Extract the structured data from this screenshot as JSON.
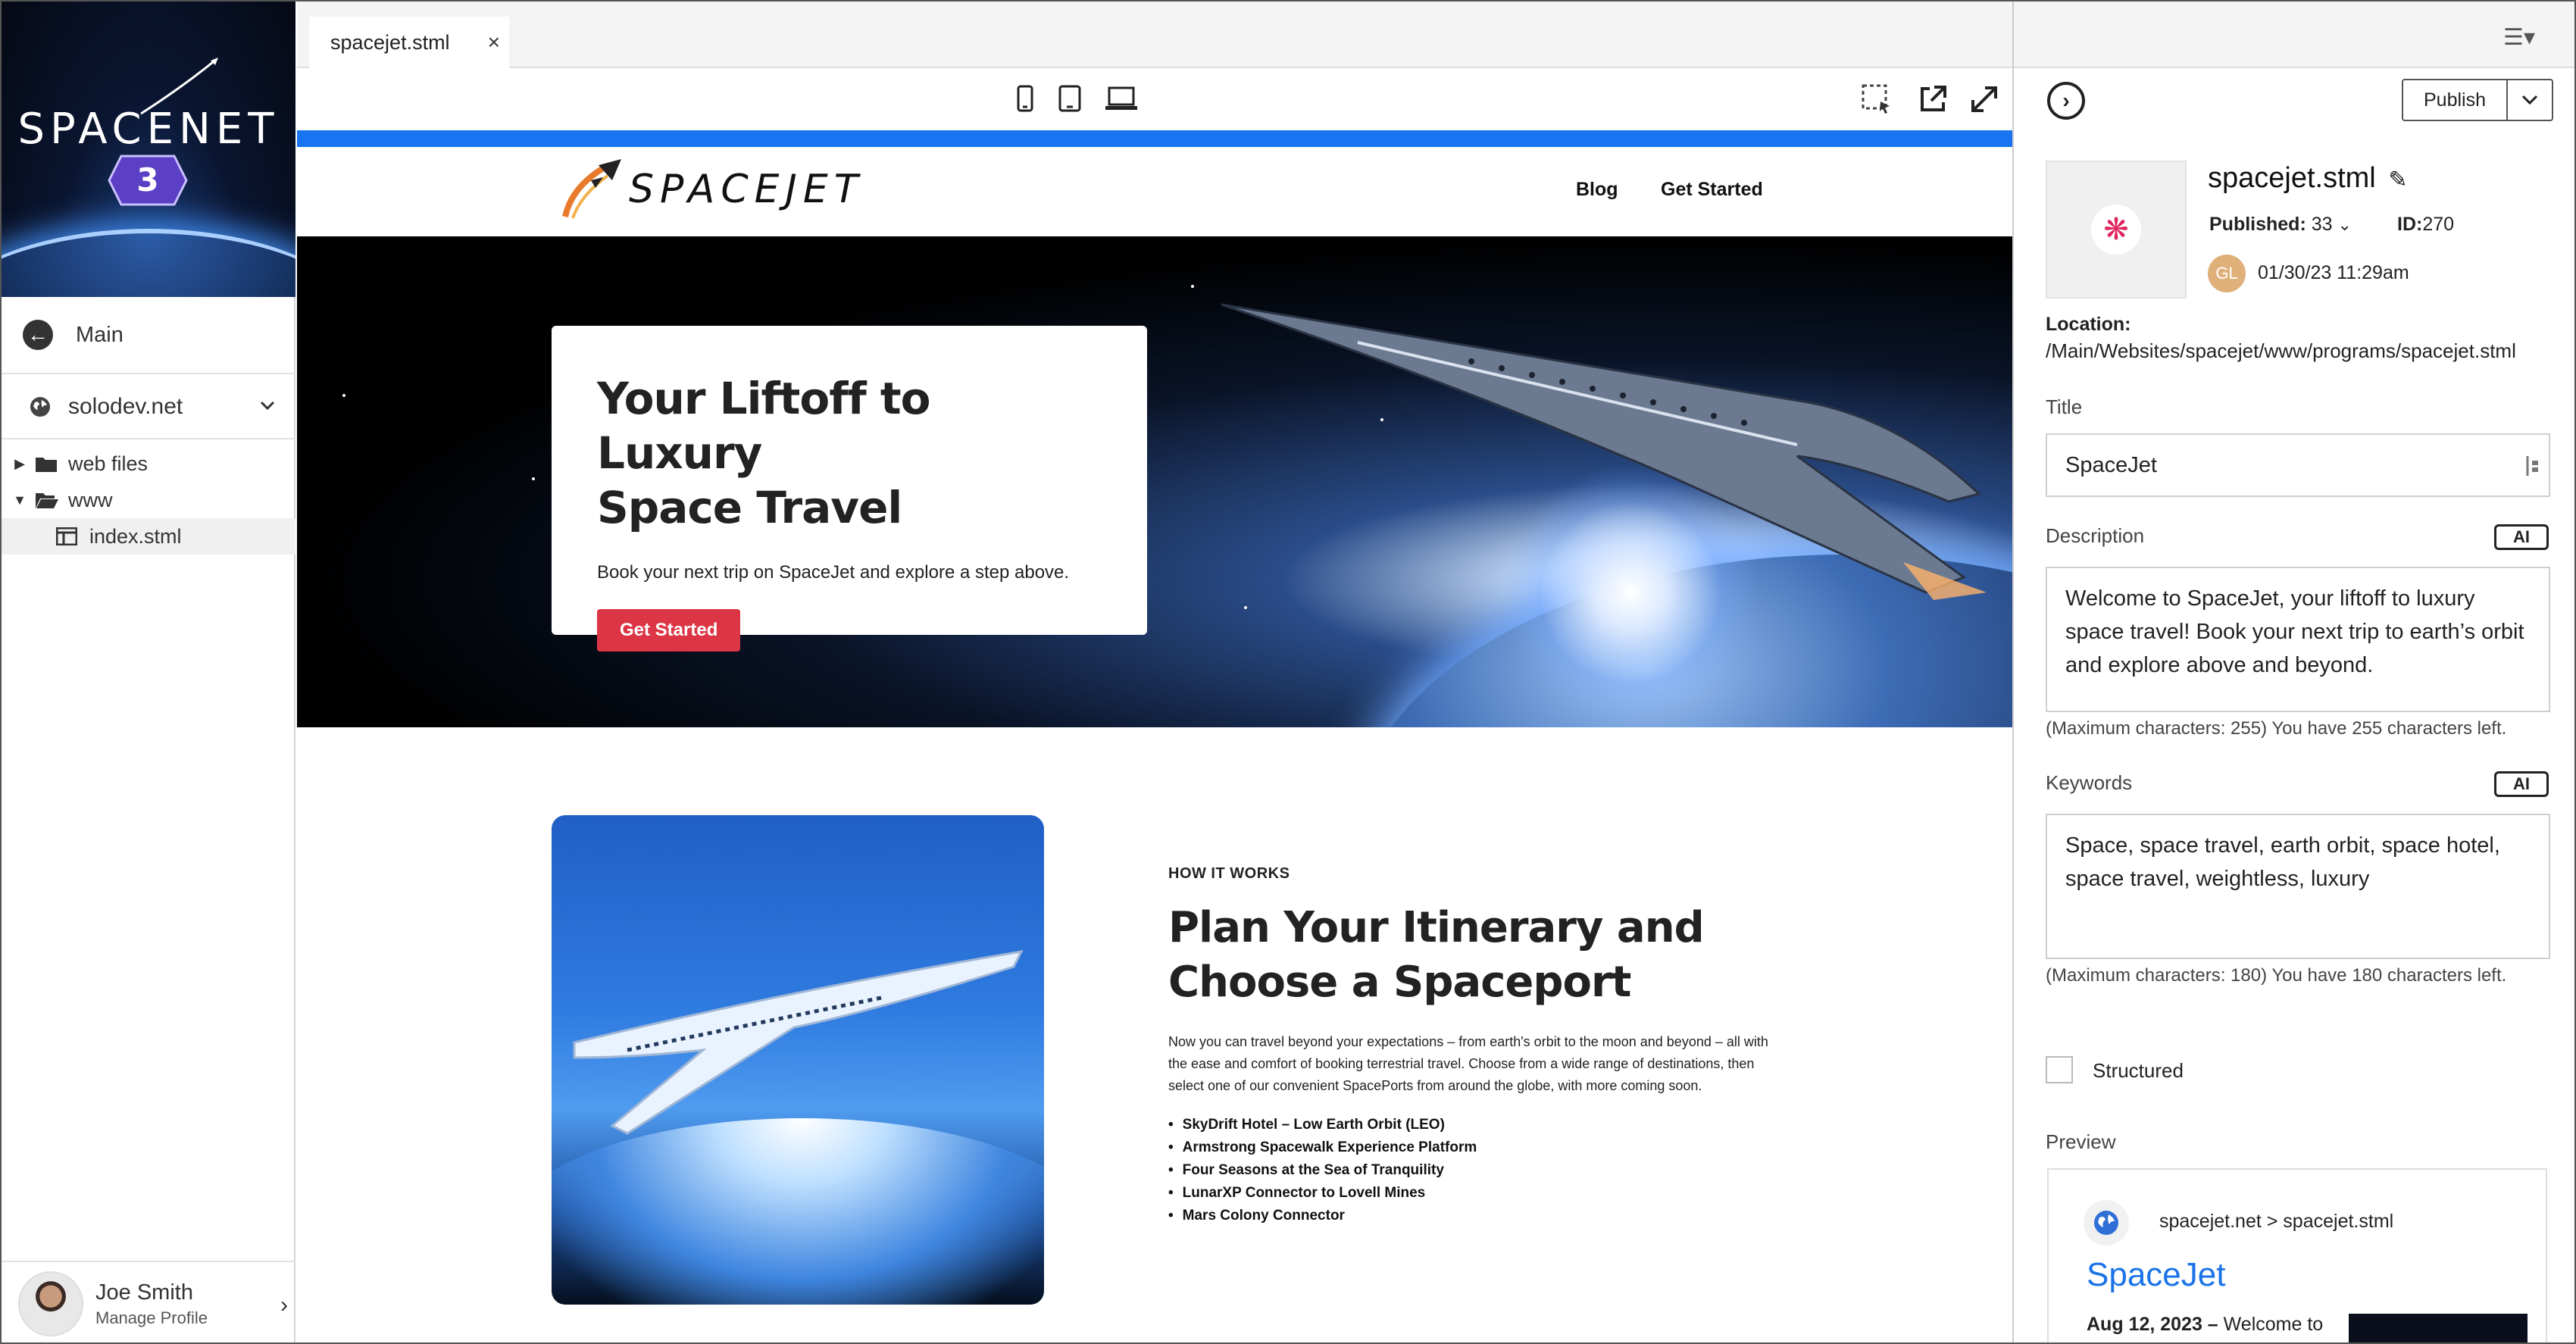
{
  "brand": {
    "name": "SPACENET",
    "badge_number": "3"
  },
  "sidebar": {
    "main_label": "Main",
    "site": "solodev.net",
    "tree": [
      {
        "label": "web files",
        "type": "folder",
        "expanded": false
      },
      {
        "label": "www",
        "type": "folder",
        "expanded": true
      },
      {
        "label": "index.stml",
        "type": "page",
        "selected": true
      }
    ],
    "profile": {
      "name": "Joe Smith",
      "sub": "Manage Profile"
    }
  },
  "editor": {
    "tab": {
      "label": "spacejet.stml",
      "close": "×"
    }
  },
  "site": {
    "logo": "SPACEJET",
    "nav": {
      "blog": "Blog",
      "get_started": "Get Started"
    },
    "hero": {
      "title_line1": "Your Liftoff to Luxury",
      "title_line2": "Space Travel",
      "text": "Book your next trip on SpaceJet and explore a step above.",
      "button": "Get Started"
    },
    "feature": {
      "eyebrow": "HOW IT WORKS",
      "title_line1": "Plan Your Itinerary and",
      "title_line2": "Choose a Spaceport",
      "body": "Now you can travel beyond your expectations – from earth's orbit to the moon and beyond – all with the ease and comfort of booking terrestrial travel. Choose from a wide range of destinations, then select one of our convenient SpacePorts from around the globe, with more coming soon.",
      "items": [
        "SkyDrift Hotel – Low Earth Orbit (LEO)",
        "Armstrong Spacewalk Experience Platform",
        "Four Seasons at the Sea of Tranquility",
        "LunarXP Connector to Lovell Mines",
        "Mars Colony Connector"
      ]
    }
  },
  "panel": {
    "publish": "Publish",
    "filename": "spacejet.stml",
    "published_label": "Published:",
    "published_value": "33",
    "id_label": "ID:",
    "id_value": "270",
    "user_initials": "GL",
    "date": "01/30/23 11:29am",
    "location_label": "Location:",
    "location": "/Main/Websites/spacejet/www/programs/spacejet.stml",
    "title_label": "Title",
    "title_value": "SpaceJet",
    "description_label": "Description",
    "description_value": "Welcome to SpaceJet, your liftoff to luxury space travel! Book your next trip to earth’s orbit and explore above and beyond.",
    "description_hint": "(Maximum characters: 255) You have 255 characters left.",
    "keywords_label": "Keywords",
    "keywords_value": "Space, space travel, earth orbit, space hotel, space travel, weightless, luxury",
    "keywords_hint": "(Maximum characters: 180) You have 180 characters left.",
    "ai_label": "AI",
    "structured_label": "Structured",
    "preview_label": "Preview",
    "preview": {
      "crumb": "spacejet.net > spacejet.stml",
      "title": "SpaceJet",
      "date": "Aug 12, 2023 –",
      "desc": " Welcome to"
    }
  },
  "colors": {
    "accent_blue": "#1874f0",
    "cta_red": "#dc3545",
    "link_blue": "#1a73e8"
  }
}
